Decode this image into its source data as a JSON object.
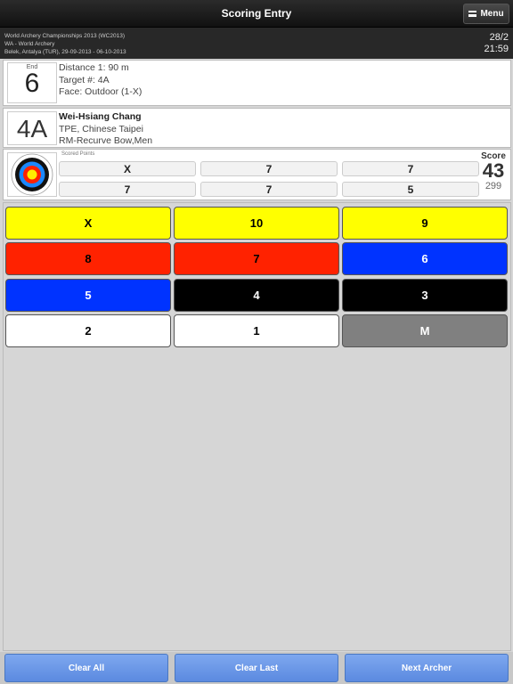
{
  "header": {
    "title": "Scoring Entry",
    "menu_label": "Menu"
  },
  "event": {
    "line1": "World Archery Championships 2013 (WC2013)",
    "line2": "WA - World Archery",
    "line3": "Belek, Antalya (TUR), 29-09-2013 - 06-10-2013",
    "counter": "28/2",
    "time": "21:59"
  },
  "end": {
    "label": "End",
    "number": "6",
    "distance": "Distance 1: 90 m",
    "target": "Target #: 4A",
    "face": "Face: Outdoor (1-X)"
  },
  "archer": {
    "target": "4A",
    "name": "Wei-Hsiang Chang",
    "country": "TPE, Chinese Taipei",
    "division": "RM-Recurve Bow,Men"
  },
  "scored": {
    "label": "Scored Points",
    "arrows": [
      "X",
      "7",
      "7",
      "7",
      "7",
      "5"
    ],
    "score_label": "Score",
    "end_total": "43",
    "running_total": "299"
  },
  "keypad": {
    "keys": [
      {
        "label": "X",
        "bg": "#ffff00",
        "fg": "#000000"
      },
      {
        "label": "10",
        "bg": "#ffff00",
        "fg": "#000000"
      },
      {
        "label": "9",
        "bg": "#ffff00",
        "fg": "#000000"
      },
      {
        "label": "8",
        "bg": "#ff2200",
        "fg": "#000000"
      },
      {
        "label": "7",
        "bg": "#ff2200",
        "fg": "#000000"
      },
      {
        "label": "6",
        "bg": "#0033ff",
        "fg": "#ffffff"
      },
      {
        "label": "5",
        "bg": "#0033ff",
        "fg": "#ffffff"
      },
      {
        "label": "4",
        "bg": "#000000",
        "fg": "#ffffff"
      },
      {
        "label": "3",
        "bg": "#000000",
        "fg": "#ffffff"
      },
      {
        "label": "2",
        "bg": "#ffffff",
        "fg": "#000000"
      },
      {
        "label": "1",
        "bg": "#ffffff",
        "fg": "#000000"
      },
      {
        "label": "M",
        "bg": "#808080",
        "fg": "#ffffff"
      }
    ]
  },
  "footer": {
    "clear_all": "Clear All",
    "clear_last": "Clear Last",
    "next_archer": "Next Archer"
  }
}
